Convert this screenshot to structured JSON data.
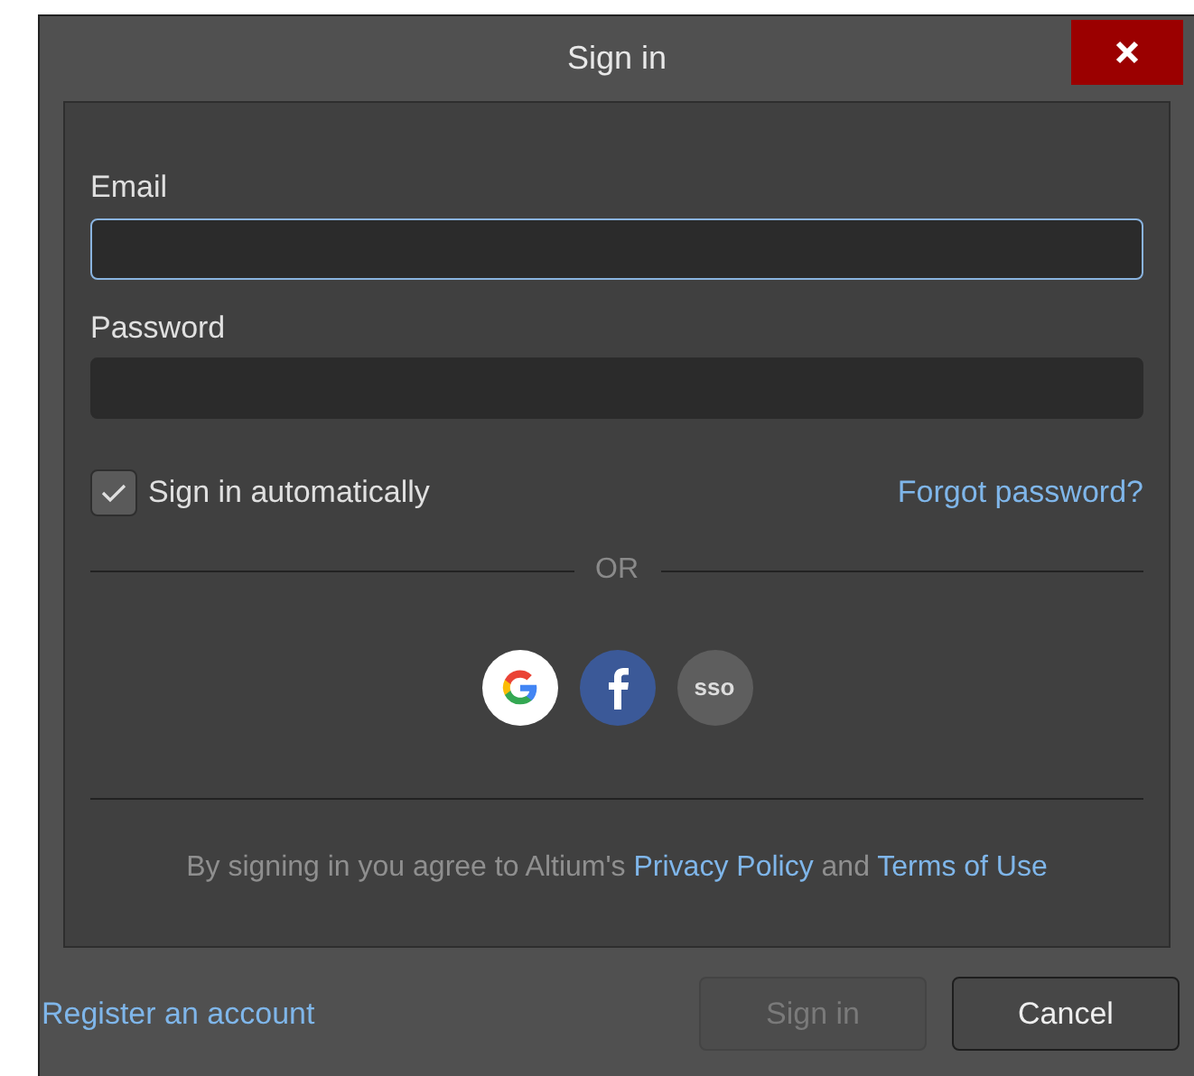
{
  "window": {
    "title": "Sign in"
  },
  "fields": [
    {
      "label": "Email",
      "focused": true
    },
    {
      "label": "Password",
      "focused": false
    }
  ],
  "remember": {
    "label": "Sign in automatically",
    "checked": true
  },
  "forgot_link": "Forgot password?",
  "divider_text": "OR",
  "social": [
    {
      "kind": "google"
    },
    {
      "kind": "facebook"
    },
    {
      "kind": "sso",
      "label": "sso"
    }
  ],
  "agreement": {
    "text": "By signing in you agree to Altium's",
    "privacy_link": "Privacy Policy",
    "and": "and",
    "terms_link": "Terms of Use"
  },
  "register_link": "Register an account",
  "buttons": [
    {
      "label": "Sign in",
      "disabled": true
    },
    {
      "label": "Cancel",
      "disabled": false
    }
  ]
}
